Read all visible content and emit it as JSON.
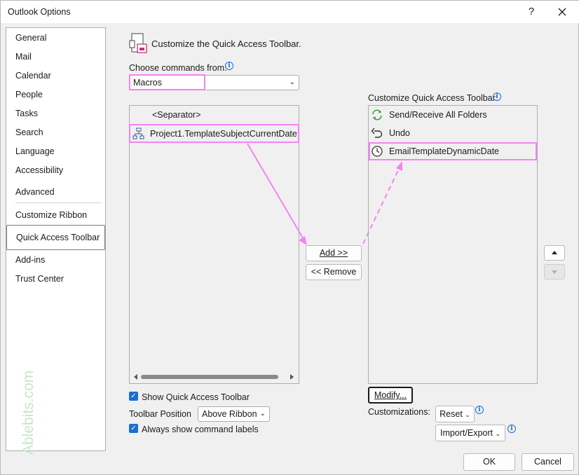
{
  "window": {
    "title": "Outlook Options",
    "help_glyph": "?",
    "close_icon": "close-icon"
  },
  "nav": {
    "items": [
      {
        "label": "General"
      },
      {
        "label": "Mail"
      },
      {
        "label": "Calendar"
      },
      {
        "label": "People"
      },
      {
        "label": "Tasks"
      },
      {
        "label": "Search"
      },
      {
        "label": "Language"
      },
      {
        "label": "Accessibility"
      },
      {
        "label": "Advanced"
      },
      {
        "label": "Customize Ribbon"
      },
      {
        "label": "Quick Access Toolbar",
        "selected": true
      },
      {
        "label": "Add-ins"
      },
      {
        "label": "Trust Center"
      }
    ]
  },
  "watermark": {
    "text": "Ablebits.com"
  },
  "main": {
    "heading": "Customize the Quick Access Toolbar.",
    "choose_label": "Choose commands from:",
    "choose_value": "Macros",
    "left_list": [
      "<Separator>",
      "Project1.TemplateSubjectCurrentDate"
    ],
    "right_label": "Customize Quick Access Toolbar:",
    "right_list": [
      "Send/Receive All Folders",
      "Undo",
      "EmailTemplateDynamicDate"
    ],
    "add_button": "Add >>",
    "remove_button": "<< Remove",
    "modify_button": "Modify...",
    "show_qat_label": "Show Quick Access Toolbar",
    "show_qat_checked": true,
    "toolbar_position_label": "Toolbar Position",
    "toolbar_position_value": "Above Ribbon",
    "always_show_label": "Always show command labels",
    "always_show_checked": true,
    "customizations_label": "Customizations:",
    "reset_button": "Reset",
    "import_export_button": "Import/Export"
  },
  "footer": {
    "ok": "OK",
    "cancel": "Cancel"
  },
  "colors": {
    "highlight": "#f483f4",
    "accent": "#1a6fd0",
    "watermark": "#c8e6c8"
  }
}
